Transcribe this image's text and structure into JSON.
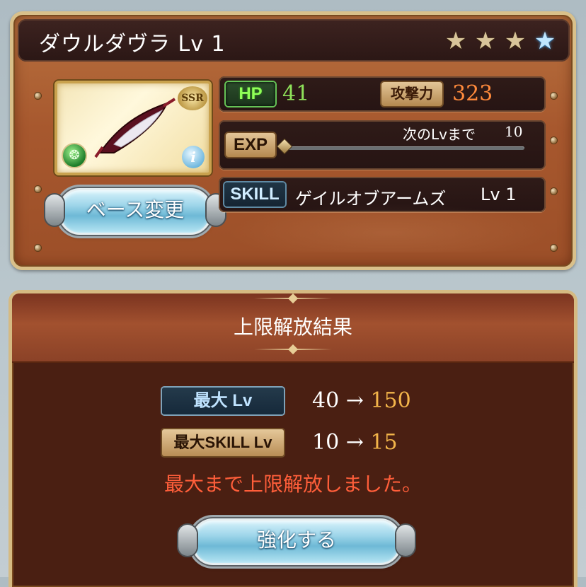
{
  "weapon": {
    "name_level": "ダウルダヴラ Lv 1",
    "rarity_badge": "SSR",
    "stars_total": 4,
    "stars_uncapped": 3
  },
  "stats": {
    "hp_label": "HP",
    "hp_value": "41",
    "atk_label": "攻撃力",
    "atk_value": "323",
    "exp_label": "EXP",
    "next_level_text": "次のLvまで",
    "next_level_value": "10",
    "exp_progress": 0.0
  },
  "skill": {
    "label": "SKILL",
    "name": "ゲイルオブアームズ",
    "level": "Lv 1"
  },
  "buttons": {
    "base_change": "ベース変更",
    "enhance": "強化する"
  },
  "result": {
    "title": "上限解放結果",
    "max_lv_label": "最大 Lv",
    "max_lv_from": "40",
    "max_lv_to": "150",
    "max_skill_label": "最大SKILL Lv",
    "max_skill_from": "10",
    "max_skill_to": "15",
    "arrow": "→",
    "notice": "最大まで上限解放しました。"
  },
  "colors": {
    "hp_green": "#8fe25a",
    "atk_orange": "#ff8a3c",
    "new_value_gold": "#f3b54a",
    "notice_red": "#ff5e3a"
  },
  "icons": [
    "star-icon",
    "wind-element-icon",
    "info-icon"
  ]
}
